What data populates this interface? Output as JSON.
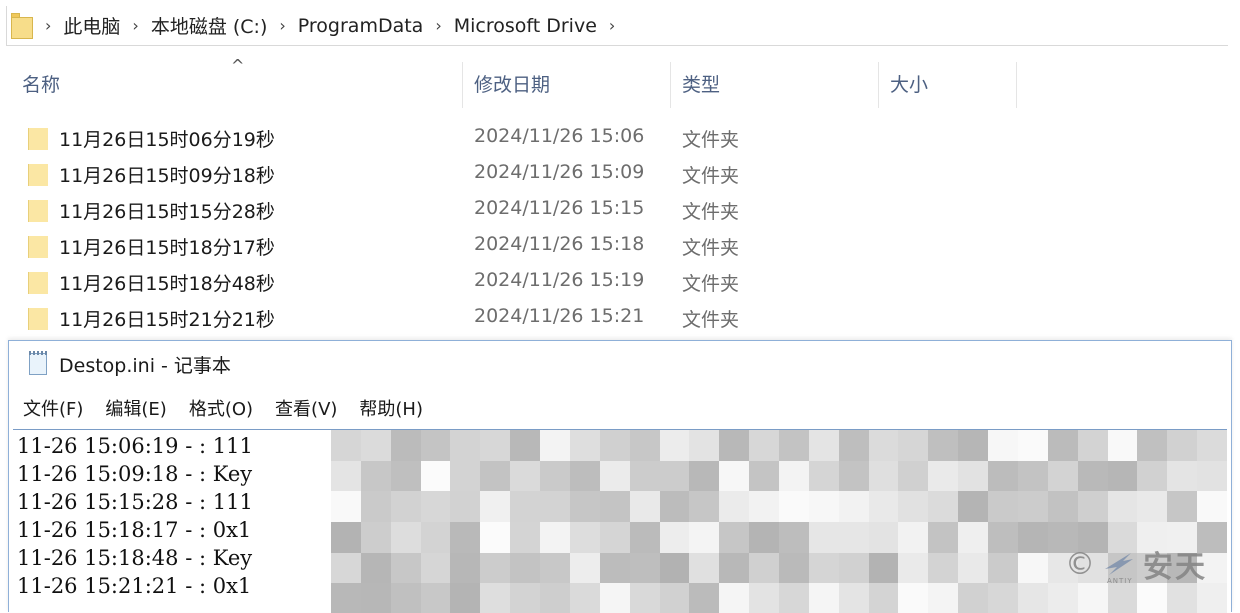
{
  "explorer": {
    "breadcrumb": [
      "此电脑",
      "本地磁盘 (C:)",
      "ProgramData",
      "Microsoft Drive"
    ],
    "columns": {
      "name": "名称",
      "date": "修改日期",
      "type": "类型",
      "size": "大小"
    },
    "rows": [
      {
        "name": "11月26日15时06分19秒",
        "date": "2024/11/26 15:06",
        "type": "文件夹"
      },
      {
        "name": "11月26日15时09分18秒",
        "date": "2024/11/26 15:09",
        "type": "文件夹"
      },
      {
        "name": "11月26日15时15分28秒",
        "date": "2024/11/26 15:15",
        "type": "文件夹"
      },
      {
        "name": "11月26日15时18分17秒",
        "date": "2024/11/26 15:18",
        "type": "文件夹"
      },
      {
        "name": "11月26日15时18分48秒",
        "date": "2024/11/26 15:19",
        "type": "文件夹"
      },
      {
        "name": "11月26日15时21分21秒",
        "date": "2024/11/26 15:21",
        "type": "文件夹"
      }
    ]
  },
  "notepad": {
    "title": "Destop.ini - 记事本",
    "menu": [
      "文件(F)",
      "编辑(E)",
      "格式(O)",
      "查看(V)",
      "帮助(H)"
    ],
    "lines": [
      "11-26 15:06:19 - : 111",
      "11-26 15:09:18 - : Key",
      "11-26 15:15:28 - : 111",
      "11-26 15:18:17 - : 0x1",
      "11-26 15:18:48 - : Key",
      "11-26 15:21:21 - : 0x1"
    ]
  },
  "watermark": {
    "copyright": "©",
    "brand": "安天",
    "brand_small": "ANTIY"
  }
}
